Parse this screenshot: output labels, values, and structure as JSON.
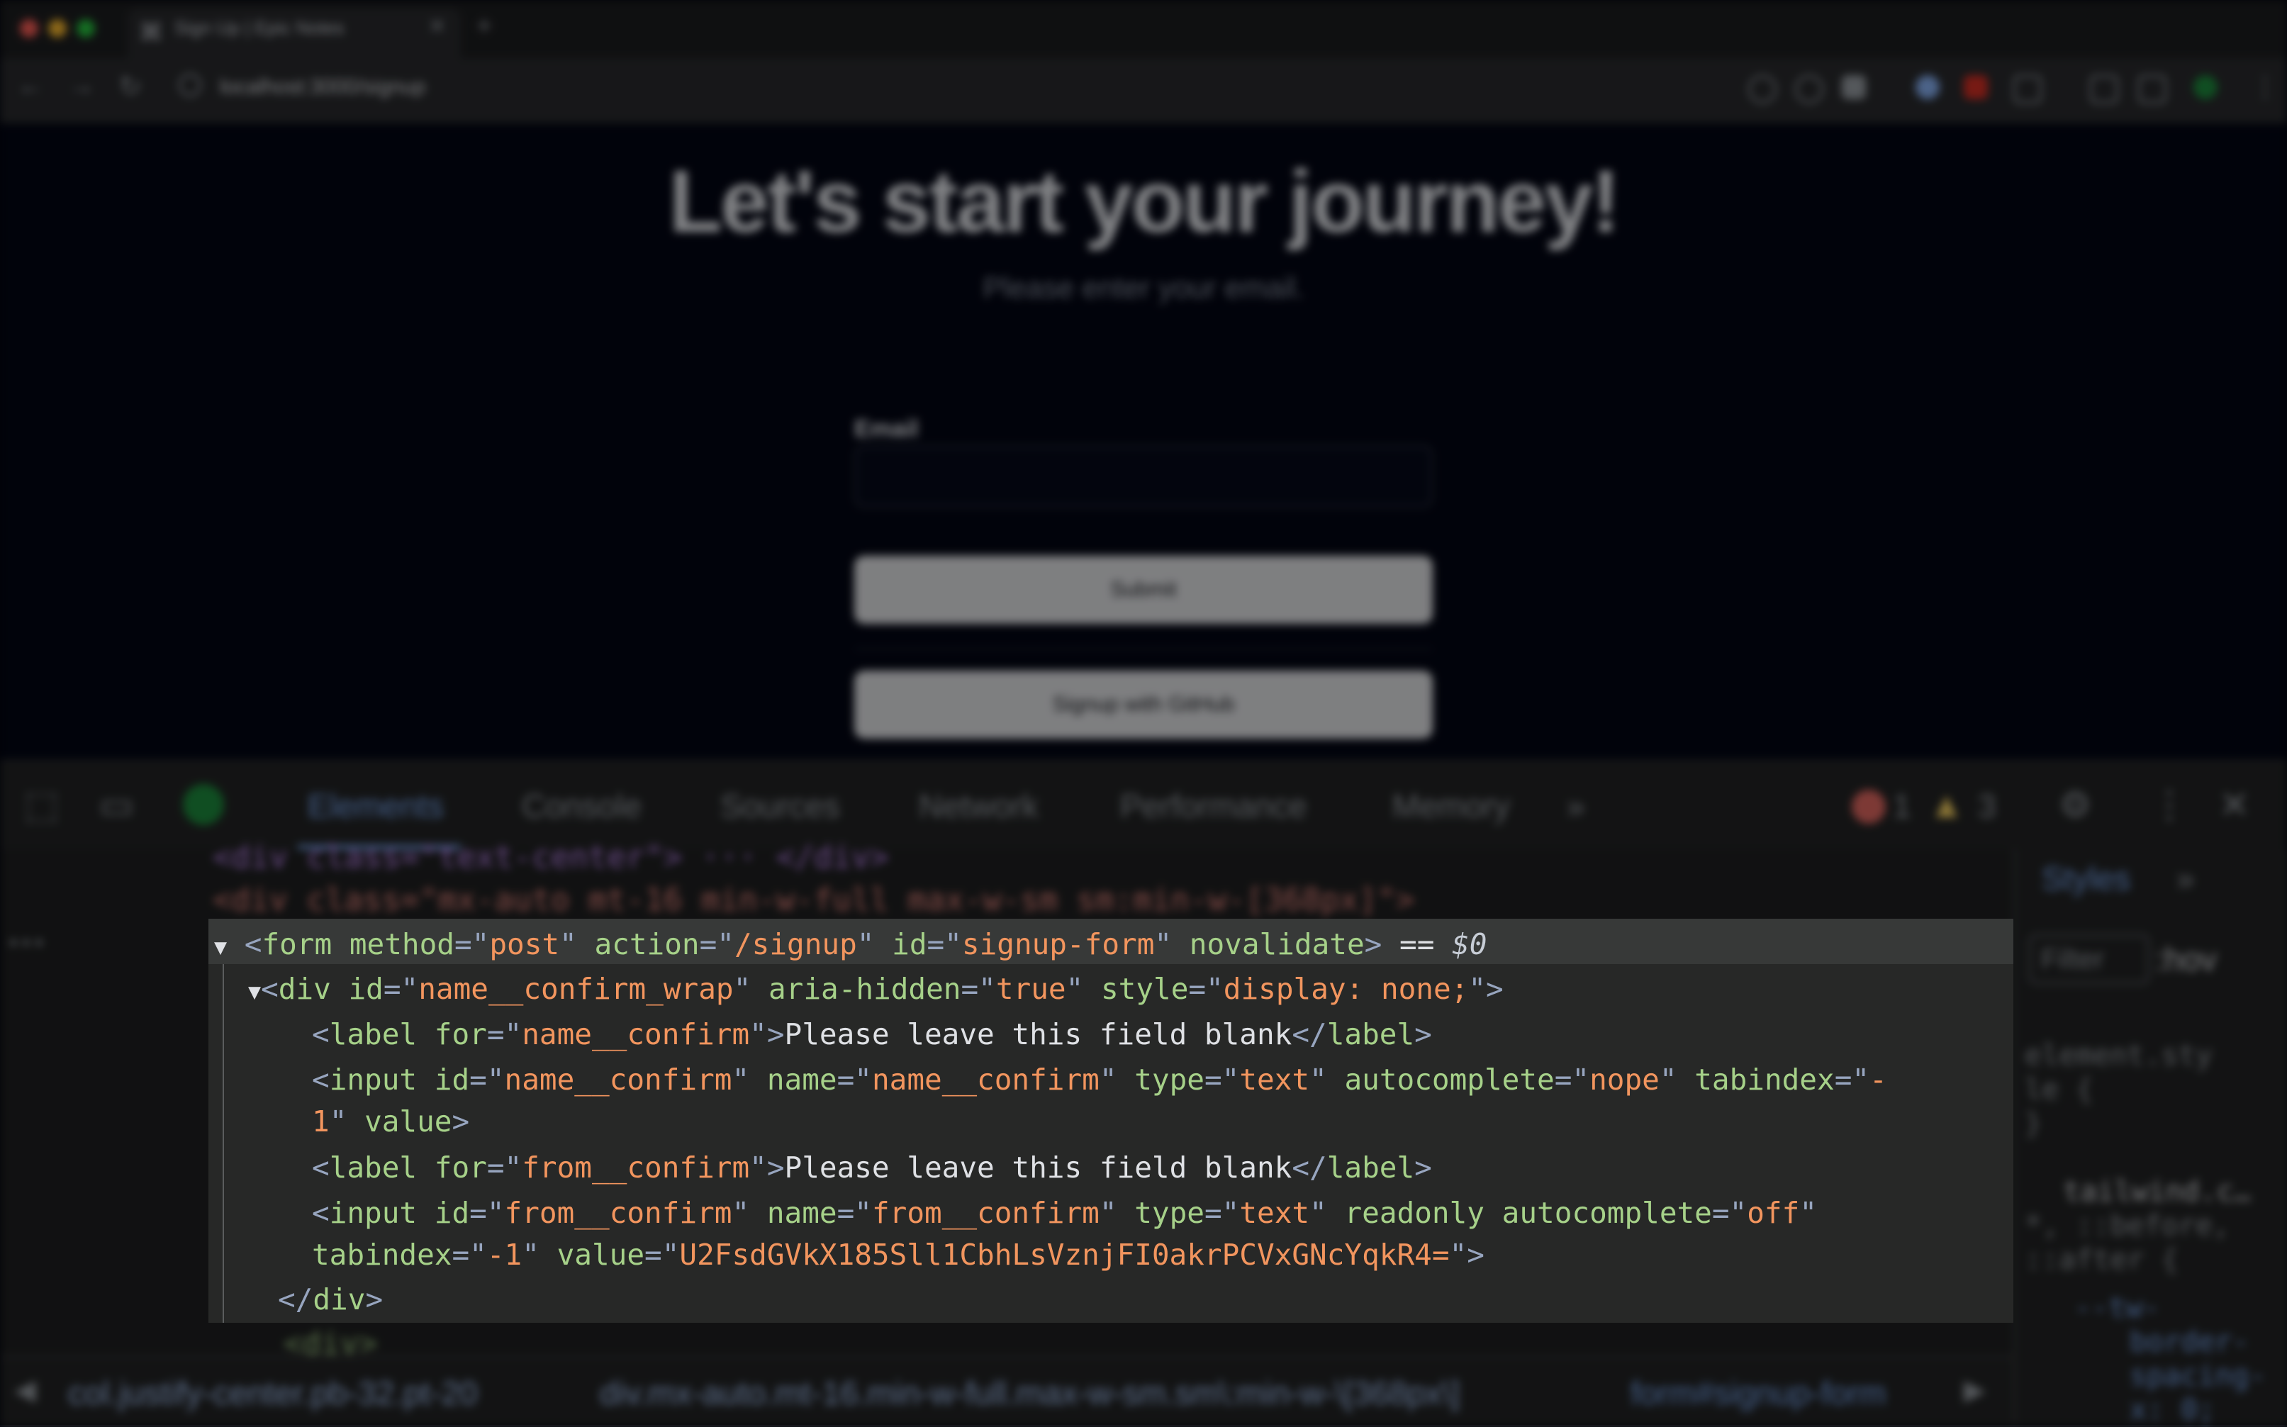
{
  "browser": {
    "tab_title": "Sign Up | Epic Notes",
    "url": "localhost:3000/signup"
  },
  "page": {
    "heading": "Let's start your journey!",
    "subheading": "Please enter your email.",
    "email_label": "Email",
    "submit_label": "Submit",
    "github_label": "Signup with GitHub"
  },
  "devtools": {
    "tabs": [
      "Elements",
      "Console",
      "Sources",
      "Network",
      "Performance",
      "Memory"
    ],
    "more": "»",
    "errors": "1",
    "warnings": "3",
    "styles_tab": "Styles",
    "styles_more": "»",
    "filter_placeholder": "Filter",
    "hov": ":hov",
    "bg_lines": [
      "<div class=\"text-center\"> ··· </div>",
      "<div class=\"mx-auto mt-16 min-w-full max-w-sm sm:min-w-[368px]\">",
      "<div>"
    ],
    "styles_text": [
      "element.sty",
      "le {",
      "}",
      "tailwind.c…",
      "*, ::before,",
      "::after {",
      "--tw-",
      "border-",
      "spacing-",
      "x: 0;"
    ],
    "breadcrumbs": [
      "col.justify-center.pb-32.pt-20",
      "div.mx-auto.mt-16.min-w-full.max-w-sm.sm\\:min-w-\\[368px\\]",
      "form#signup-form"
    ]
  },
  "code": {
    "form_line": {
      "tag": "form",
      "method_attr": "method",
      "method_val": "post",
      "action_attr": "action",
      "action_val": "/signup",
      "id_attr": "id",
      "id_val": "signup-form",
      "novalidate": "novalidate",
      "selected_marker": "$0"
    },
    "div_line": {
      "tag": "div",
      "id_attr": "id",
      "id_val": "name__confirm_wrap",
      "aria_attr": "aria-hidden",
      "aria_val": "true",
      "style_attr": "style",
      "style_val": "display: none;"
    },
    "label1": {
      "tag": "label",
      "for_attr": "for",
      "for_val": "name__confirm",
      "text": "Please leave this field blank"
    },
    "input1": {
      "tag": "input",
      "id_val": "name__confirm",
      "name_val": "name__confirm",
      "type_val": "text",
      "autocomplete_val": "nope",
      "tabindex_val_a": "-",
      "tabindex_val_b": "1"
    },
    "label2": {
      "tag": "label",
      "for_attr": "for",
      "for_val": "from__confirm",
      "text": "Please leave this field blank"
    },
    "input2": {
      "tag": "input",
      "id_val": "from__confirm",
      "name_val": "from__confirm",
      "type_val": "text",
      "readonly": "readonly",
      "autocomplete_val": "off",
      "tabindex_val": "-1",
      "value_val": "U2FsdGVkX185Sll1CbhLsVznjFI0akrPCVxGNcYqkR4="
    },
    "close_div": "div"
  },
  "colors": {
    "tag": "#a6d189",
    "attribute": "#a6d189",
    "value": "#f2955e",
    "text": "#dfe1e5",
    "bracket": "#97a5bf",
    "panel_bg": "#272827",
    "highlight_row": "#373938"
  }
}
